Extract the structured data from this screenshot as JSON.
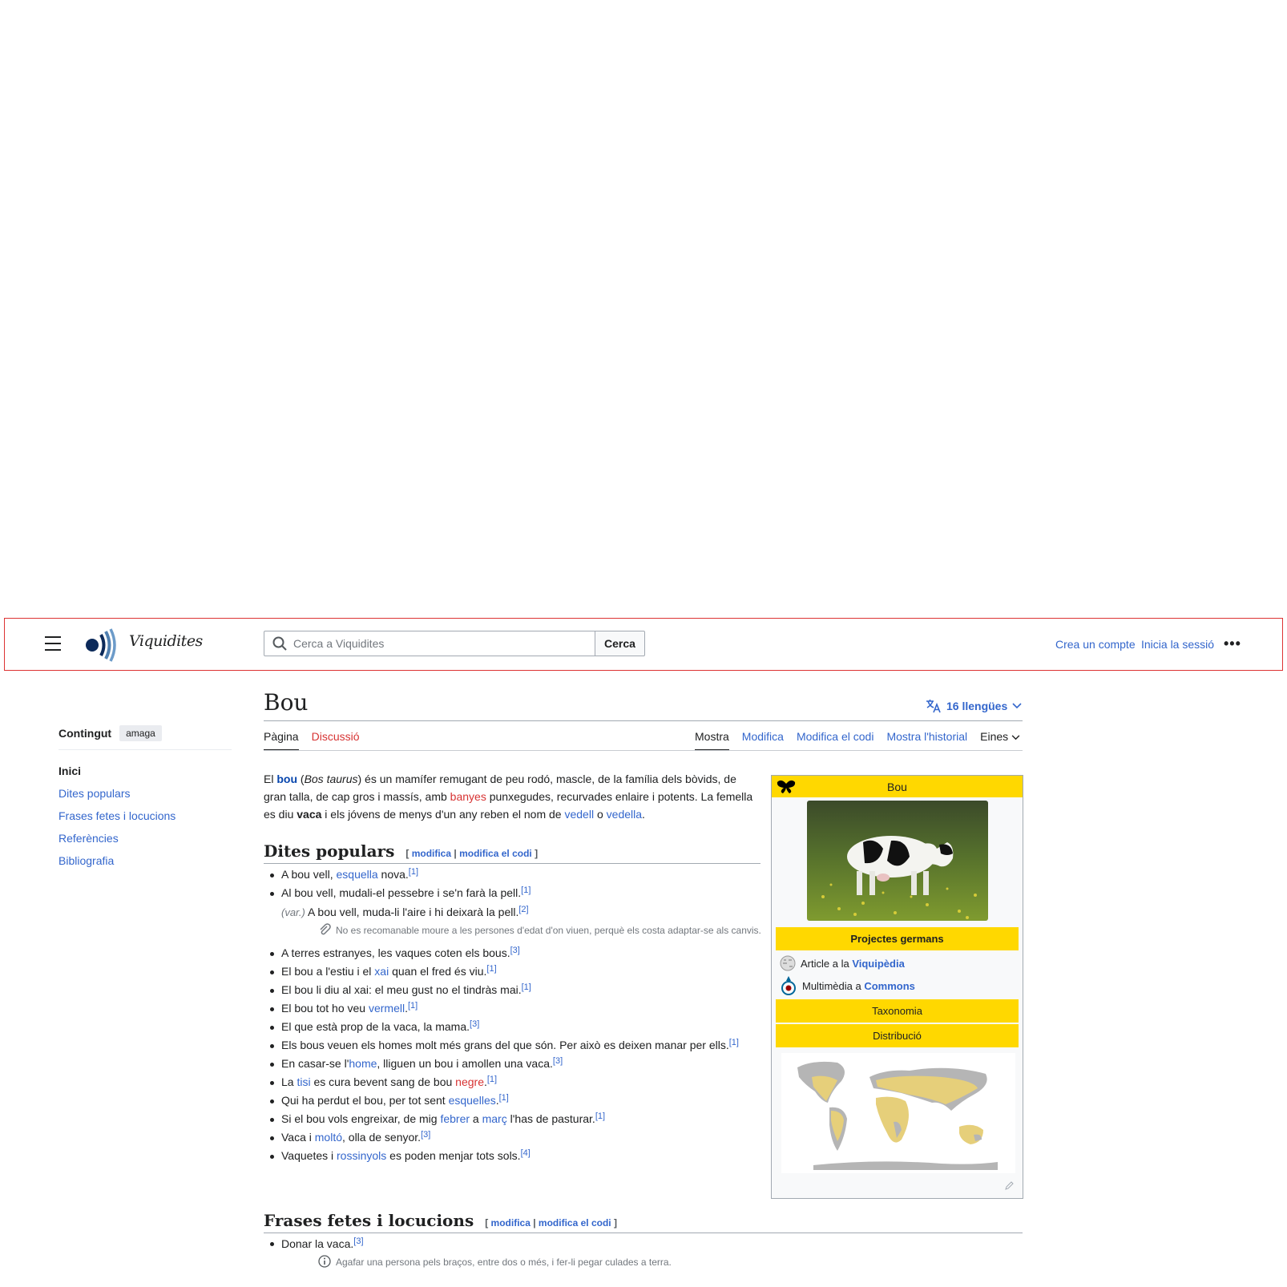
{
  "header": {
    "menu_label": "Menú principal",
    "wordmark": "Viquidites",
    "search_placeholder": "Cerca a Viquidites",
    "search_button": "Cerca",
    "create_account": "Crea un compte",
    "login": "Inicia la sessió",
    "more": "•••"
  },
  "toc": {
    "title": "Contingut",
    "hide": "amaga",
    "items": [
      "Inici",
      "Dites populars",
      "Frases fetes i locucions",
      "Referències",
      "Bibliografia"
    ]
  },
  "page": {
    "title": "Bou",
    "languages": "16 llengües",
    "tabs_left": [
      "Pàgina",
      "Discussió"
    ],
    "tabs_right": [
      "Mostra",
      "Modifica",
      "Modifica el codi",
      "Mostra l'historial",
      "Eines"
    ]
  },
  "intro": {
    "p1": "El ",
    "bou": "bou",
    "p2": " (",
    "sci": "Bos taurus",
    "p3": ") és un mamífer remugant de peu rodó, mascle, de la família dels bòvids, de gran talla, de cap gros i massís, amb ",
    "banyes": "banyes",
    "p4": " punxegudes, recurvades enlaire i potents. La femella es diu ",
    "vaca": "vaca",
    "p5": " i els jóvens de menys d'un any reben el nom de ",
    "vedell": "vedell",
    "p6": " o ",
    "vedella": "vedella",
    "p7": "."
  },
  "sections": {
    "dites": "Dites populars",
    "frases": "Frases fetes i locucions",
    "edit_open": "[ ",
    "edit": "modifica",
    "sep": " | ",
    "edit_code": "modifica el codi",
    "edit_close": " ]"
  },
  "quotes": {
    "q1a": "A bou vell, ",
    "q1l": "esquella",
    "q1b": " nova.",
    "q1r": "[1]",
    "q2": "Al bou vell, mudali-el pessebre i se'n farà la pell.",
    "q2r": "[1]",
    "var_label": "(var.)",
    "var_text": " A bou vell, muda-li l'aire i hi deixarà la pell.",
    "var_r": "[2]",
    "note": "No es recomanable moure a les persones d'edat d'on viuen, perquè els costa adaptar-se als canvis.",
    "q3": "A terres estranyes, les vaques coten els bous.",
    "q3r": "[3]",
    "q4a": "El bou a l'estiu i el ",
    "q4l": "xai",
    "q4b": " quan el fred és viu.",
    "q4r": "[1]",
    "q5": "El bou li diu al xai: el meu gust no el tindràs mai.",
    "q5r": "[1]",
    "q6a": "El bou tot ho veu ",
    "q6l": "vermell",
    "q6b": ".",
    "q6r": "[1]",
    "q7": "El que està prop de la vaca, la mama.",
    "q7r": "[3]",
    "q8": "Els bous veuen els homes molt més grans del que són. Per això es deixen manar per ells.",
    "q8r": "[1]",
    "q9a": "En casar-se l'",
    "q9l": "home",
    "q9b": ", lliguen un bou i amollen una vaca.",
    "q9r": "[3]",
    "q10a": "La ",
    "q10l": "tisi",
    "q10b": " es cura bevent sang de bou ",
    "q10l2": "negre",
    "q10c": ".",
    "q10r": "[1]",
    "q11a": "Qui ha perdut el bou, per tot sent ",
    "q11l": "esquelles",
    "q11b": ".",
    "q11r": "[1]",
    "q12a": "Si el bou vols engreixar, de mig ",
    "q12l": "febrer",
    "q12b": " a ",
    "q12l2": "març",
    "q12c": " l'has de pasturar.",
    "q12r": "[1]",
    "q13a": "Vaca i ",
    "q13l": "moltó",
    "q13b": ", olla de senyor.",
    "q13r": "[3]",
    "q14a": "Vaquetes i ",
    "q14l": "rossinyols",
    "q14b": " es poden menjar tots sols.",
    "q14r": "[4]"
  },
  "phrases": {
    "p1": "Donar la vaca.",
    "p1r": "[3]",
    "p1note": "Agafar una persona pels braços, entre dos o més, i fer-li pegar culades a terra."
  },
  "infobox": {
    "title": "Bou",
    "sister": "Projectes germans",
    "wp_text": "Article a la ",
    "wp_link": "Viquipèdia",
    "cm_text": "Multimèdia a ",
    "cm_link": "Commons",
    "taxonomy": "Taxonomia",
    "distribution": "Distribució"
  },
  "colors": {
    "link": "#3366cc",
    "redlink": "#d73333",
    "infobox_band": "#ffd800",
    "map_range": "#e6cf7a",
    "map_land": "#b5b5b5"
  }
}
